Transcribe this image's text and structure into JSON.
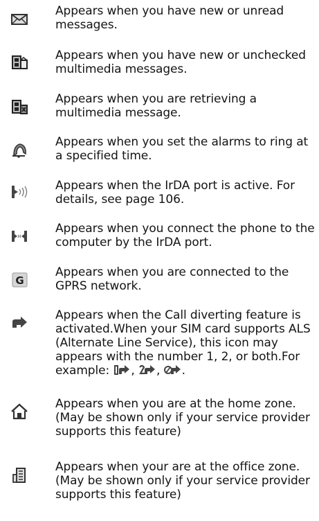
{
  "items": [
    {
      "icon": "envelope-icon",
      "text": "Appears when you have new or unread messages."
    },
    {
      "icon": "multimedia-message-icon",
      "text": "Appears when you have new or unchecked multimedia messages."
    },
    {
      "icon": "retrieving-multimedia-icon",
      "text": "Appears when you are retrieving a multimedia message."
    },
    {
      "icon": "alarm-bell-icon",
      "text": "Appears when you set the alarms to ring at a specified time."
    },
    {
      "icon": "irda-active-icon",
      "text": "Appears when the IrDA port is active. For details, see page 106."
    },
    {
      "icon": "irda-connected-icon",
      "text": "Appears when you connect the phone to the computer by the IrDA port."
    },
    {
      "icon": "gprs-icon",
      "text": "Appears when you are connected to the GPRS network."
    },
    {
      "icon": "call-divert-icon",
      "text": "Appears when the Call diverting feature is activated.When your SIM card supports ALS (Alternate Line Service), this icon may appears with the number 1, 2, or both.For example:",
      "example_sep": ",",
      "example_end": "."
    },
    {
      "icon": "home-zone-icon",
      "text": "Appears when you are at the home zone. (May be shown only if your service provider supports this feature)"
    },
    {
      "icon": "office-zone-icon",
      "text": "Appears when your are at the office zone. (May be shown only if your service provider supports this feature)"
    }
  ]
}
